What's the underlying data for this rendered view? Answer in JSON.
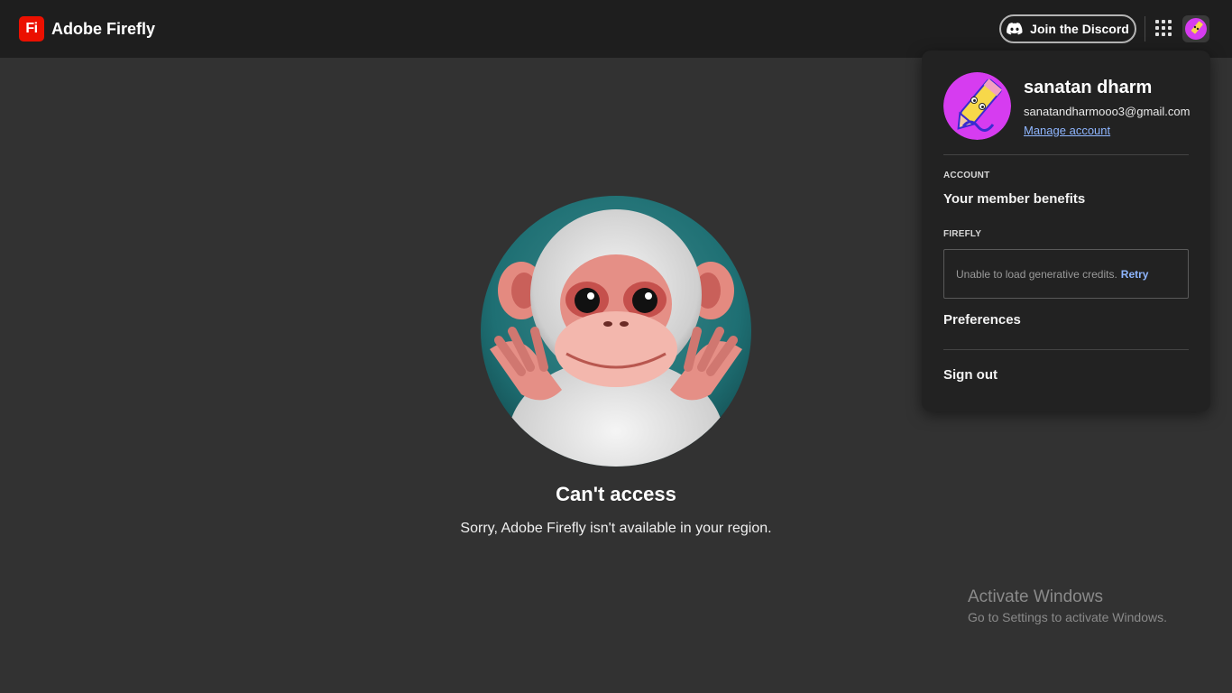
{
  "header": {
    "logo_text": "Fi",
    "brand_name": "Adobe Firefly",
    "discord_label": "Join the Discord"
  },
  "main": {
    "title": "Can't access",
    "message": "Sorry, Adobe Firefly isn't available in your region."
  },
  "account_menu": {
    "user_name": "sanatan dharm",
    "email": "sanatandharmooo3@gmail.com",
    "manage_account": "Manage account",
    "account_section": "ACCOUNT",
    "member_benefits": "Your member benefits",
    "firefly_section": "FIREFLY",
    "credits_error": "Unable to load generative credits.",
    "retry_label": "Retry",
    "preferences": "Preferences",
    "sign_out": "Sign out"
  },
  "watermark": {
    "title": "Activate Windows",
    "subtitle": "Go to Settings to activate Windows."
  },
  "colors": {
    "brand_red": "#eb1000",
    "link_blue": "#8fb6ff",
    "background": "#323232",
    "header_bg": "#1e1e1e",
    "avatar_magenta": "#d63cf0"
  }
}
